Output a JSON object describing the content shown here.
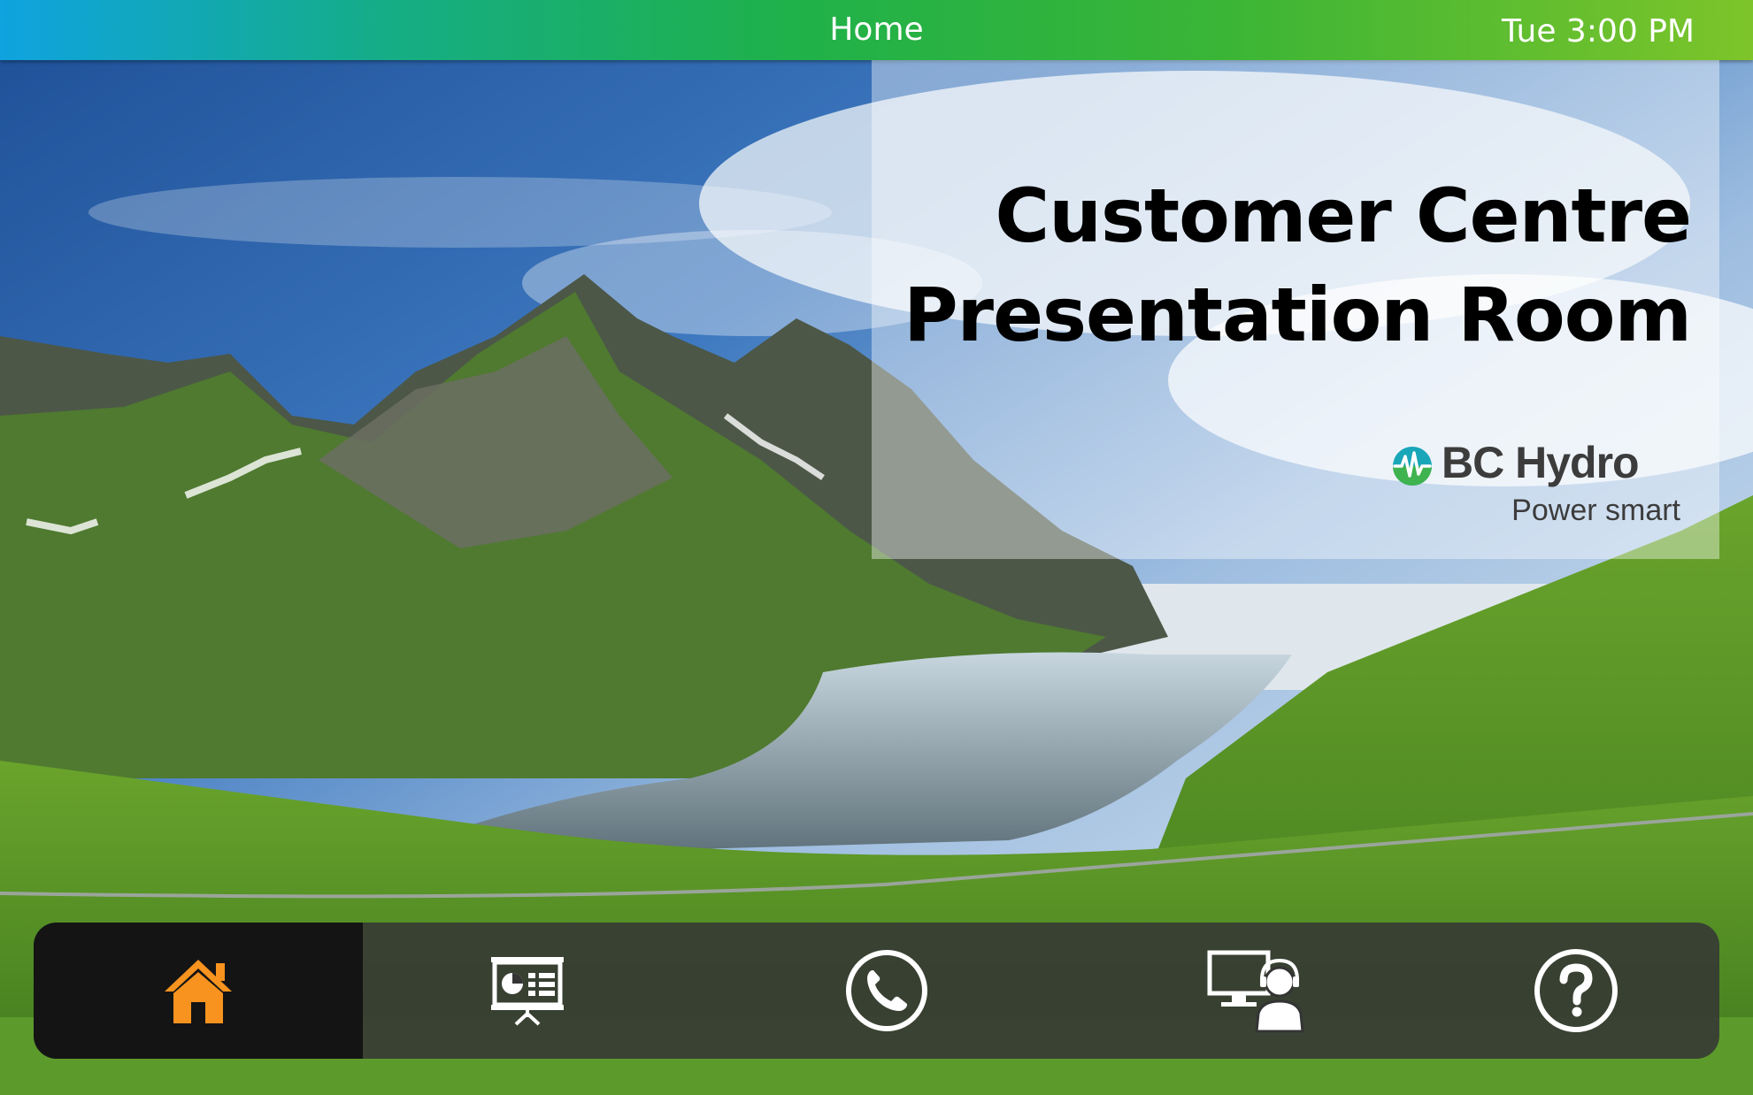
{
  "status_bar": {
    "title": "Home",
    "clock": "Tue 3:00 PM"
  },
  "room": {
    "title_line1": "Customer Centre",
    "title_line2": "Presentation Room"
  },
  "brand": {
    "name": "BC Hydro",
    "tagline": "Power smart"
  },
  "nav": {
    "active_index": 0,
    "items": [
      {
        "icon": "home-icon",
        "active": true
      },
      {
        "icon": "presentation-icon",
        "active": false
      },
      {
        "icon": "phone-icon",
        "active": false
      },
      {
        "icon": "computer-support-icon",
        "active": false
      },
      {
        "icon": "help-icon",
        "active": false
      }
    ]
  },
  "colors": {
    "active_icon": "#f7931e",
    "icon": "#ffffff",
    "nav_background": "#343434",
    "nav_active_background": "#141414",
    "gradient_start": "#0fa3e0",
    "gradient_end": "#7dc42a"
  }
}
